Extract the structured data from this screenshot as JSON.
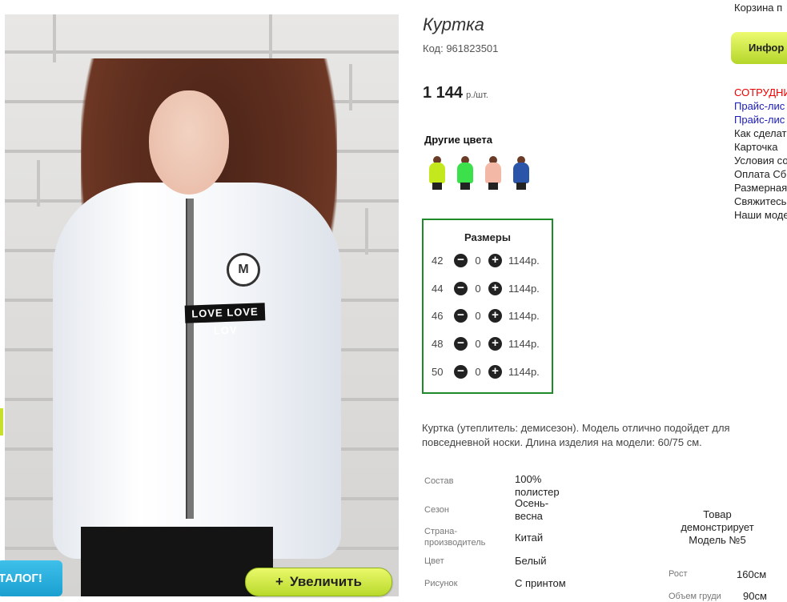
{
  "photo": {
    "band_text": "LOVE LOVE LOV",
    "badge_letter": "M",
    "zoom_button": "Увеличить",
    "zoom_plus": "+",
    "catalog_label": "ТАЛОГ!"
  },
  "product": {
    "title": "Куртка",
    "code": "Код: 961823501",
    "price": "1 144",
    "price_unit": "р./шт.",
    "other_colors_title": "Другие цвета",
    "other_colors": [
      {
        "name": "lime",
        "color": "#c4e81e"
      },
      {
        "name": "green",
        "color": "#3be04a"
      },
      {
        "name": "peach",
        "color": "#f4b9a6"
      },
      {
        "name": "blue",
        "color": "#2a55a8"
      }
    ],
    "sizes_title": "Размеры",
    "sizes": [
      {
        "size": "42",
        "qty": "0",
        "price": "1144р."
      },
      {
        "size": "44",
        "qty": "0",
        "price": "1144р."
      },
      {
        "size": "46",
        "qty": "0",
        "price": "1144р."
      },
      {
        "size": "48",
        "qty": "0",
        "price": "1144р."
      },
      {
        "size": "50",
        "qty": "0",
        "price": "1144р."
      }
    ],
    "description": "Куртка (утеплитель: демисезон). Модель отлично подойдет для повседневной носки. Длина изделия на модели: 60/75 см.",
    "specs": [
      {
        "label": "Состав",
        "value": "100% полистер"
      },
      {
        "label": "Сезон",
        "value": "Осень-весна"
      },
      {
        "label": "Страна-производитель",
        "value": "Китай"
      },
      {
        "label": "Цвет",
        "value": "Белый"
      },
      {
        "label": "Рисунок",
        "value": "С принтом"
      }
    ],
    "model_caption": "Товар демонстрирует Модель №5",
    "model_specs": [
      {
        "label": "Рост",
        "value": "160см"
      },
      {
        "label": "Объем груди",
        "value": "90см"
      }
    ]
  },
  "sidebar": {
    "cart": "Корзина п",
    "info_button": "Инфор",
    "links": [
      "СОТРУДНИ",
      "Прайс-лис",
      "Прайс-лис",
      "Как сделат",
      "Карточка",
      "Условия со",
      "Оплата Сб",
      "Размерная",
      "Свяжитесь",
      "Наши моде"
    ]
  }
}
